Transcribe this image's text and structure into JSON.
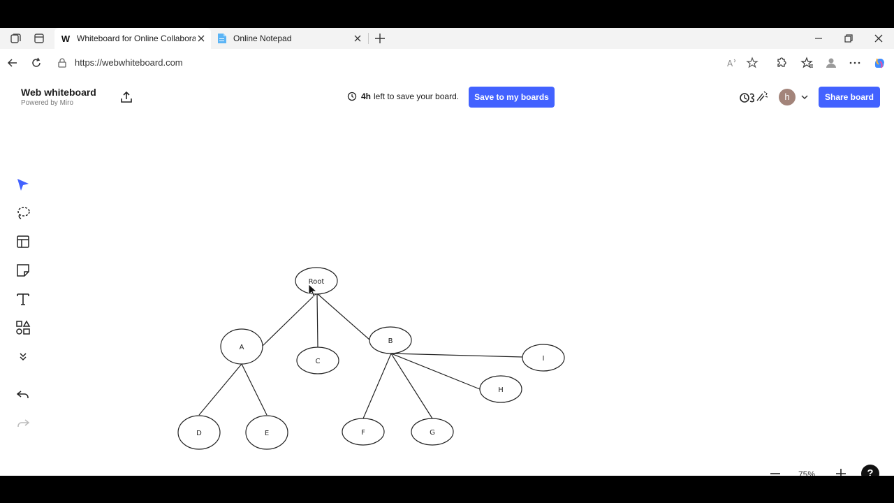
{
  "browser": {
    "tabs": [
      {
        "title": "Whiteboard for Online Collabora",
        "favicon": "W",
        "active": true
      },
      {
        "title": "Online Notepad",
        "favicon": "notepad-icon",
        "active": false
      }
    ],
    "url": "https://webwhiteboard.com"
  },
  "header": {
    "brand_title": "Web whiteboard",
    "brand_subtitle": "Powered by Miro",
    "timer_value": "4h",
    "timer_text": "left to save your board.",
    "save_label": "Save to my boards",
    "avatar_initial": "h",
    "share_label": "Share board"
  },
  "colors": {
    "accent": "#4262ff",
    "avatar": "#a3847a"
  },
  "tree": {
    "nodes": [
      "Root",
      "A",
      "C",
      "B",
      "I",
      "H",
      "D",
      "E",
      "F",
      "G"
    ]
  },
  "footer": {
    "zoom": "75%"
  }
}
